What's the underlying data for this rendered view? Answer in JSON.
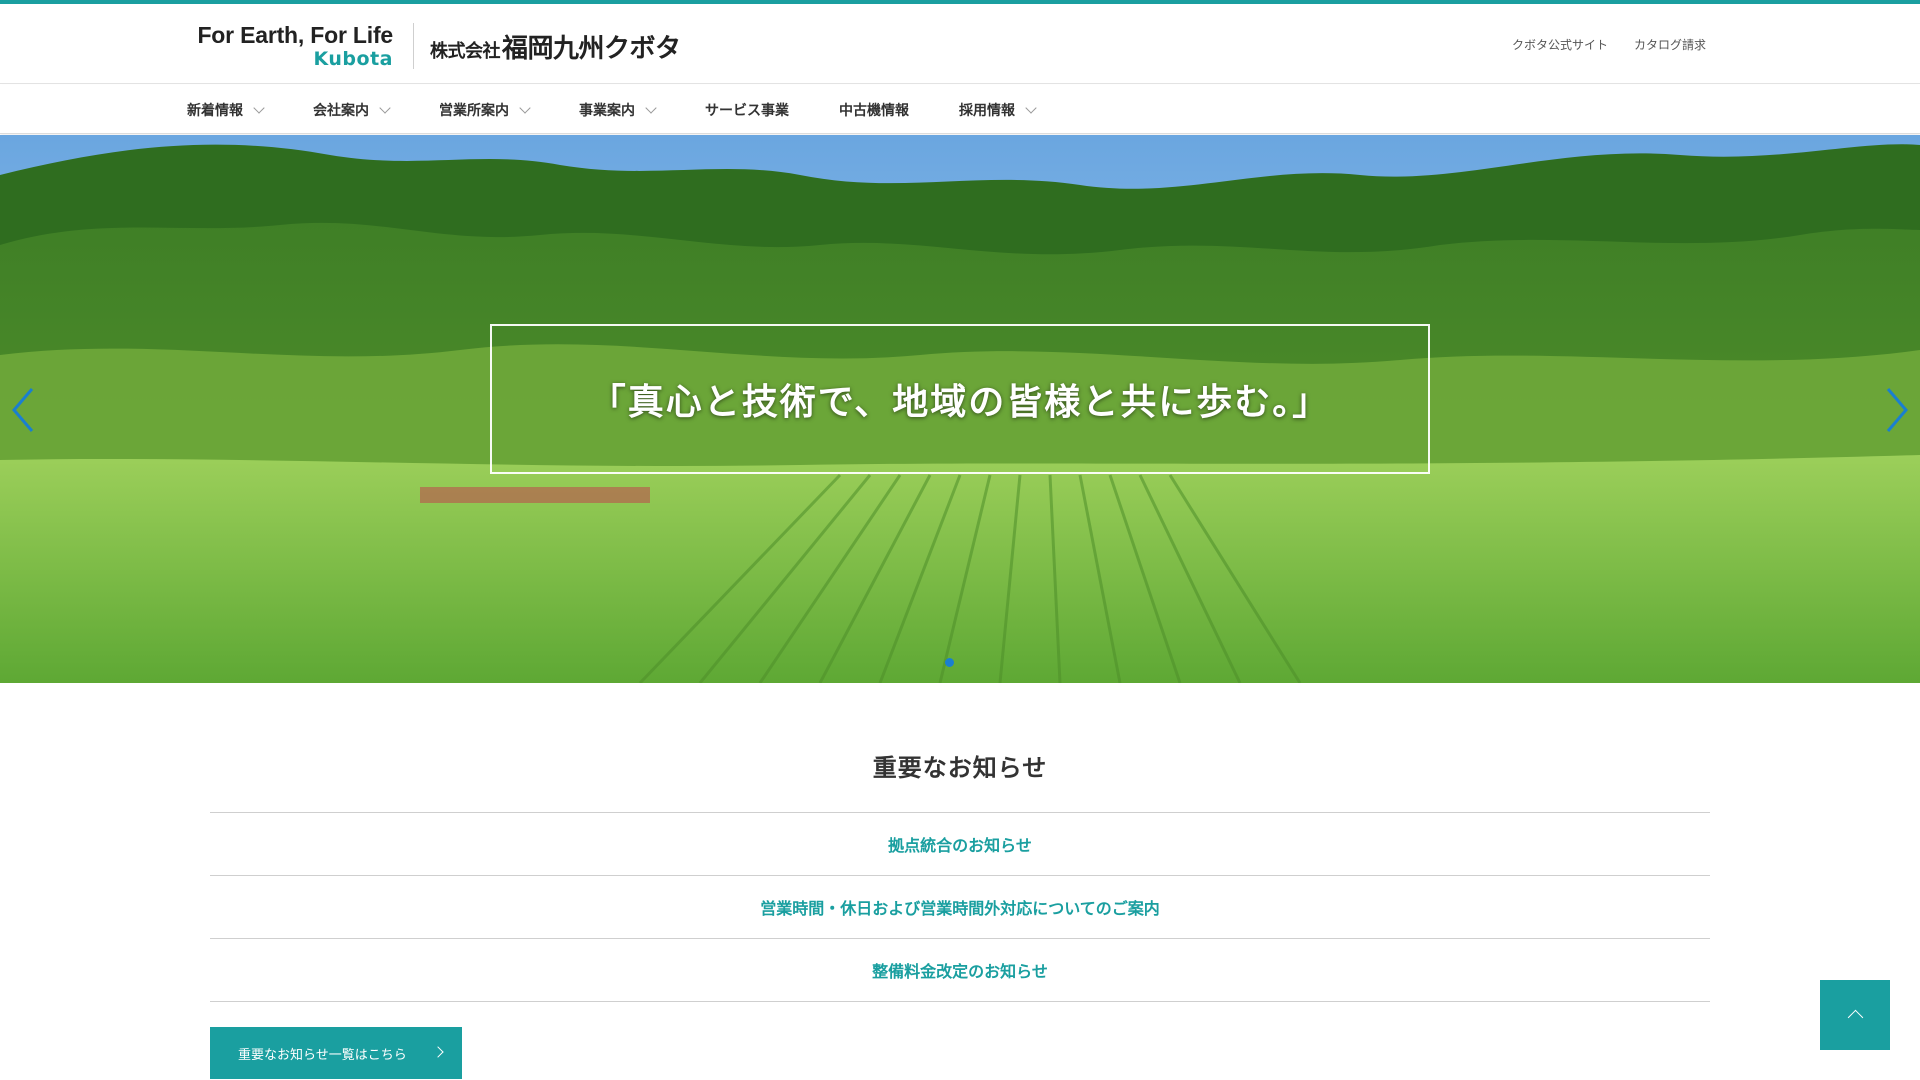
{
  "header": {
    "slogan": "For Earth, For Life",
    "brand": "Kubota",
    "company_prefix": "株式会社",
    "company_name": "福岡九州クボタ",
    "util_links": [
      "クボタ公式サイト",
      "カタログ請求"
    ]
  },
  "nav": {
    "items": [
      {
        "label": "新着情報",
        "dropdown": true
      },
      {
        "label": "会社案内",
        "dropdown": true
      },
      {
        "label": "営業所案内",
        "dropdown": true
      },
      {
        "label": "事業案内",
        "dropdown": true
      },
      {
        "label": "サービス事業",
        "dropdown": false
      },
      {
        "label": "中古機情報",
        "dropdown": false
      },
      {
        "label": "採用情報",
        "dropdown": true
      }
    ]
  },
  "hero": {
    "caption": "「真心と技術で、地域の皆様と共に歩む。」",
    "prev_icon": "chevron-left-icon",
    "next_icon": "chevron-right-icon",
    "slide_count": 1,
    "active_slide": 0
  },
  "notices": {
    "title": "重要なお知らせ",
    "items": [
      "拠点統合のお知らせ",
      "営業時間・休日および営業時間外対応についてのご案内",
      "整備料金改定のお知らせ"
    ],
    "more_label": "重要なお知らせ一覧はこちら"
  },
  "colors": {
    "accent": "#1a9fa0",
    "dot_active": "#1a7fd0"
  },
  "to_top_icon": "chevron-up-icon"
}
